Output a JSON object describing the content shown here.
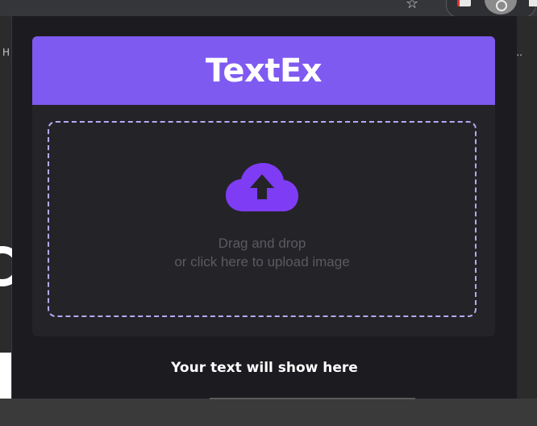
{
  "browser": {
    "bookmark_fragment": "H",
    "bookmark_overflow": "..",
    "icons": [
      "star-icon",
      "extension-icon",
      "profile-icon"
    ]
  },
  "app": {
    "title": "TextEx",
    "accent": "#7f5af0",
    "upload": {
      "icon": "cloud-upload-icon",
      "line1": "Drag and drop",
      "line2": "or click here to upload image"
    },
    "result_placeholder": "Your text will show here"
  }
}
